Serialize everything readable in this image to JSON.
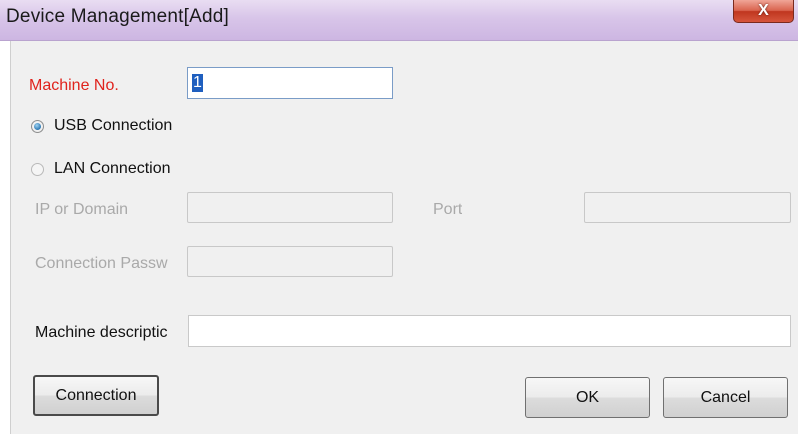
{
  "window": {
    "title": "Device Management[Add]",
    "close_label": "X"
  },
  "form": {
    "machine_no_label": "Machine No.",
    "machine_no_value": "1",
    "usb_connection_label": "USB Connection",
    "lan_connection_label": "LAN Connection",
    "connection_type_selected": "USB Connection",
    "ip_label": "IP or Domain",
    "ip_value": "",
    "port_label": "Port",
    "port_value": "",
    "password_label": "Connection Passw",
    "password_value": "",
    "description_label": "Machine descriptic",
    "description_value": ""
  },
  "buttons": {
    "connection": "Connection",
    "ok": "OK",
    "cancel": "Cancel"
  },
  "colors": {
    "required_label": "#e0231d",
    "disabled_label": "#a9a9a9",
    "title_bar": "#d8c5e9",
    "close_button": "#c0361f"
  }
}
